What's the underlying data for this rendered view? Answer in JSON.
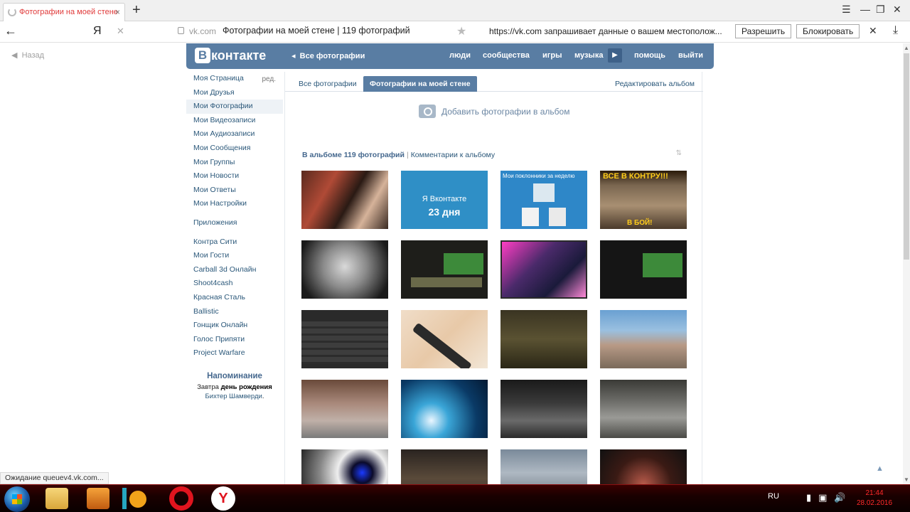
{
  "browser": {
    "tab_title": "Фотографии на моей стене",
    "address": {
      "search_engine_letter": "Я",
      "domain": "vk.com",
      "page_title": "Фотографии на моей стене | 119 фотографий"
    },
    "geo_prompt": {
      "text": "https://vk.com запрашивает данные о вашем местополож...",
      "allow_label": "Разрешить",
      "block_label": "Блокировать"
    },
    "status_text": "Ожидание queuev4.vk.com..."
  },
  "page": {
    "back_label": "Назад",
    "header": {
      "logo_letter": "В",
      "logo_text": "контакте",
      "all_photos_label": "Все фотографии",
      "nav": [
        "люди",
        "сообщества",
        "игры",
        "музыка",
        "помощь",
        "выйти"
      ]
    },
    "left_menu": {
      "edit_label": "ред.",
      "items": [
        "Моя Страница",
        "Мои Друзья",
        "Мои Фотографии",
        "Мои Видеозаписи",
        "Мои Аудиозаписи",
        "Мои Сообщения",
        "Мои Группы",
        "Мои Новости",
        "Мои Ответы",
        "Мои Настройки"
      ],
      "active_index": 2,
      "apps_label": "Приложения",
      "games": [
        "Контра Сити",
        "Мои Гости",
        "Carball 3d Онлайн",
        "Shoot4cash",
        "Красная Сталь",
        "Ballistic",
        "Гонщик Онлайн",
        "Голос Припяти",
        "Project Warfare"
      ]
    },
    "reminder": {
      "title": "Напоминание",
      "line1_pre": "Завтра ",
      "line1_bold": "день рождения",
      "name": " Бихтер Шамверди",
      "end": "."
    },
    "tabs": {
      "all_photos": "Все фотографии",
      "wall_photos": "Фотографии на моей стене",
      "edit_album": "Редактировать альбом"
    },
    "add_photos_label": "Добавить фотографии в альбом",
    "album": {
      "count_label": "В альбоме 119 фотографий",
      "separator": "|",
      "comments_label": "Комментарии к альбому"
    },
    "photo_texts": {
      "p2_line1": "Я Вконтакте",
      "p2_line2": "23 дня",
      "p3_title": "Мои поклонники за неделю",
      "p4_title": "ВСЕ В КОНТРУ!!!",
      "p4_bottom": "В БОЙ!"
    }
  },
  "taskbar": {
    "lang": "RU",
    "yandex_letter": "Y",
    "time": "21:44",
    "date": "28.02.2016"
  }
}
